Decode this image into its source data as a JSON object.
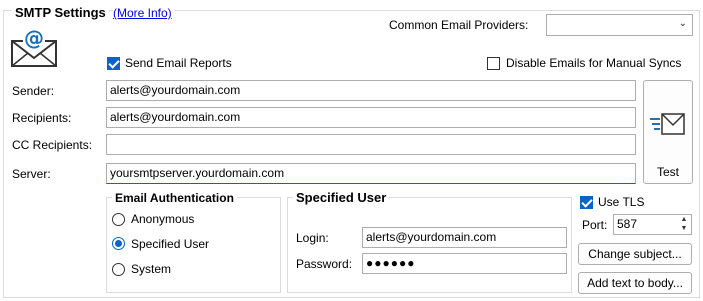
{
  "smtp": {
    "title": "SMTP Settings",
    "more_info": "(More Info)",
    "common_providers_label": "Common Email Providers:",
    "common_providers_value": "",
    "send_reports_label": "Send Email Reports",
    "send_reports_checked": true,
    "disable_manual_label": "Disable Emails for Manual Syncs",
    "disable_manual_checked": false,
    "sender_label": "Sender:",
    "sender_value": "alerts@yourdomain.com",
    "recipients_label": "Recipients:",
    "recipients_value": "alerts@yourdomain.com",
    "cc_label": "CC Recipients:",
    "cc_value": "",
    "server_label": "Server:",
    "server_value": "yoursmtpserver.yourdomain.com",
    "test_label": "Test"
  },
  "auth": {
    "title": "Email Authentication",
    "options": [
      "Anonymous",
      "Specified User",
      "System"
    ],
    "selected": "Specified User"
  },
  "specified_user": {
    "title": "Specified User",
    "login_label": "Login:",
    "login_value": "alerts@yourdomain.com",
    "password_label": "Password:",
    "password_value": "●●●●●●"
  },
  "tls": {
    "use_tls_label": "Use TLS",
    "use_tls_checked": true,
    "port_label": "Port:",
    "port_value": "587"
  },
  "buttons": {
    "change_subject": "Change subject...",
    "add_text_body": "Add text to body..."
  },
  "colors": {
    "accent": "#0a64c8",
    "border": "#adadad",
    "icon_blue": "#1a6fb5"
  }
}
